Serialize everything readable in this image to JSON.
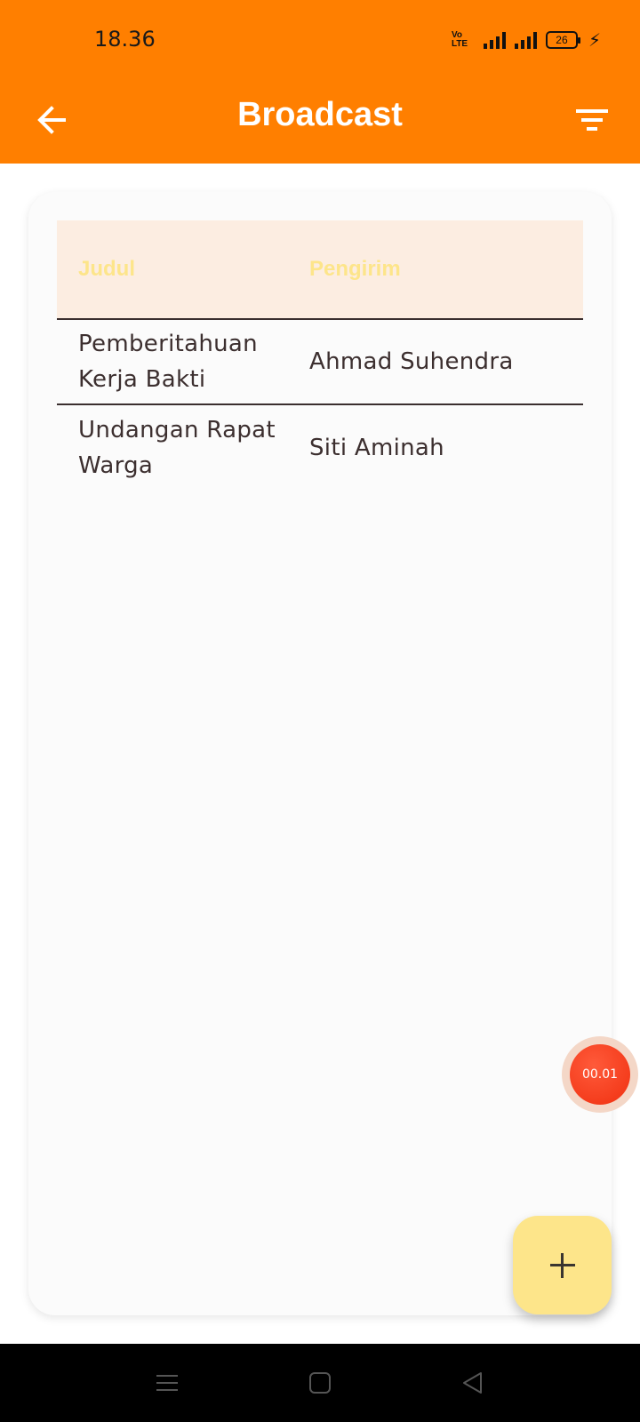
{
  "status_bar": {
    "time": "18.36",
    "network_tag": "Vo LTE",
    "battery_level": "26"
  },
  "app_bar": {
    "title": "Broadcast",
    "back_icon": "arrow-left-icon",
    "filter_icon": "filter-icon"
  },
  "table": {
    "headers": [
      "Judul",
      "Pengirim"
    ],
    "rows": [
      {
        "judul": "Pemberitahuan Kerja Bakti",
        "pengirim": "Ahmad Suhendra"
      },
      {
        "judul": "Undangan Rapat Warga",
        "pengirim": "Siti Aminah"
      }
    ]
  },
  "recording": {
    "timer": "00.01"
  },
  "fab": {
    "icon": "plus-icon"
  },
  "nav": {
    "icons": [
      "menu-icon",
      "home-square-icon",
      "back-triangle-icon"
    ]
  },
  "colors": {
    "primary": "#ff7f00",
    "header_bg": "#fcede1",
    "header_text": "#fde58a",
    "fab": "#fde58a",
    "record": "#f03010"
  }
}
